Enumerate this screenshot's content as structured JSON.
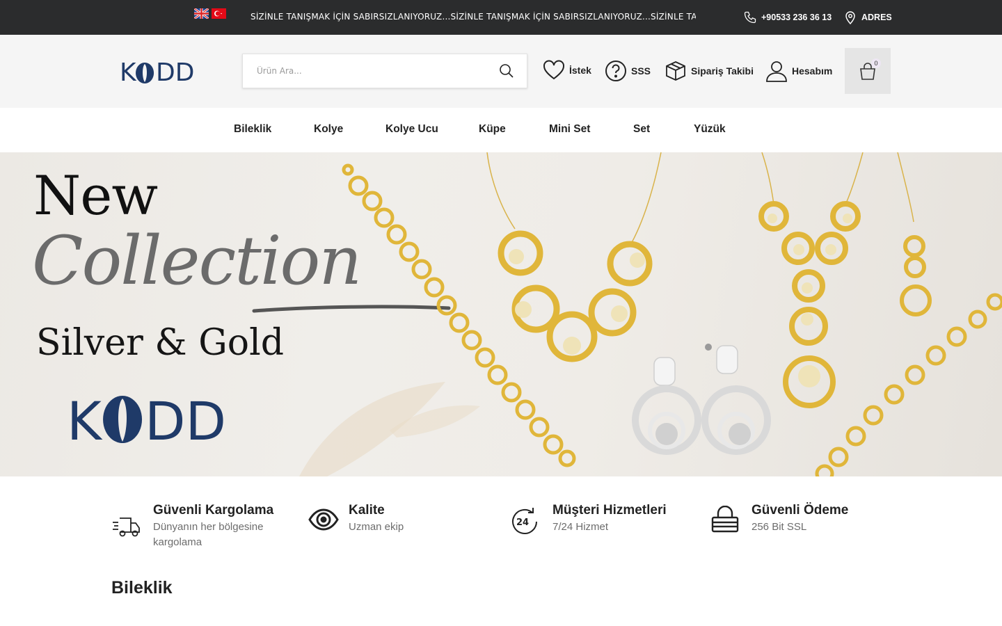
{
  "topbar": {
    "flags": [
      "uk-flag-icon",
      "tr-flag-icon"
    ],
    "marquee": "SİZİNLE TANIŞMAK İÇİN SABIRSIZLANIYORUZ...SİZİNLE TANIŞMAK İÇİN SABIRSIZLANIYORUZ...SİZİNLE TANIŞMAK İÇ",
    "phone": "+90533 236 36 13",
    "address": "ADRES"
  },
  "header": {
    "logo": "KODD",
    "search_placeholder": "Ürün Ara...",
    "wishlist": "İstek",
    "faq": "SSS",
    "order_tracking": "Sipariş Takibi",
    "account": "Hesabım",
    "cart_count": "0"
  },
  "nav": [
    "Bileklik",
    "Kolye",
    "Kolye Ucu",
    "Küpe",
    "Mini Set",
    "Set",
    "Yüzük"
  ],
  "hero": {
    "line1": "New",
    "line2": "Collection",
    "line3": "Silver & Gold",
    "brand": "KODD"
  },
  "features": [
    {
      "icon": "truck-icon",
      "title": "Güvenli Kargolama",
      "subtitle": "Dünyanın her bölgesine kargolama"
    },
    {
      "icon": "eye-icon",
      "title": "Kalite",
      "subtitle": "Uzman ekip"
    },
    {
      "icon": "24-hours-icon",
      "title": "Müşteri Hizmetleri",
      "subtitle": "7/24 Hizmet"
    },
    {
      "icon": "lock-icon",
      "title": "Güvenli Ödeme",
      "subtitle": "256 Bit SSL"
    }
  ],
  "section": {
    "title": "Bileklik"
  },
  "colors": {
    "topbar": "#2b2c2d",
    "header_bg": "#f5f5f5",
    "brand_blue": "#1f3a68",
    "gold": "#e0b63a"
  }
}
